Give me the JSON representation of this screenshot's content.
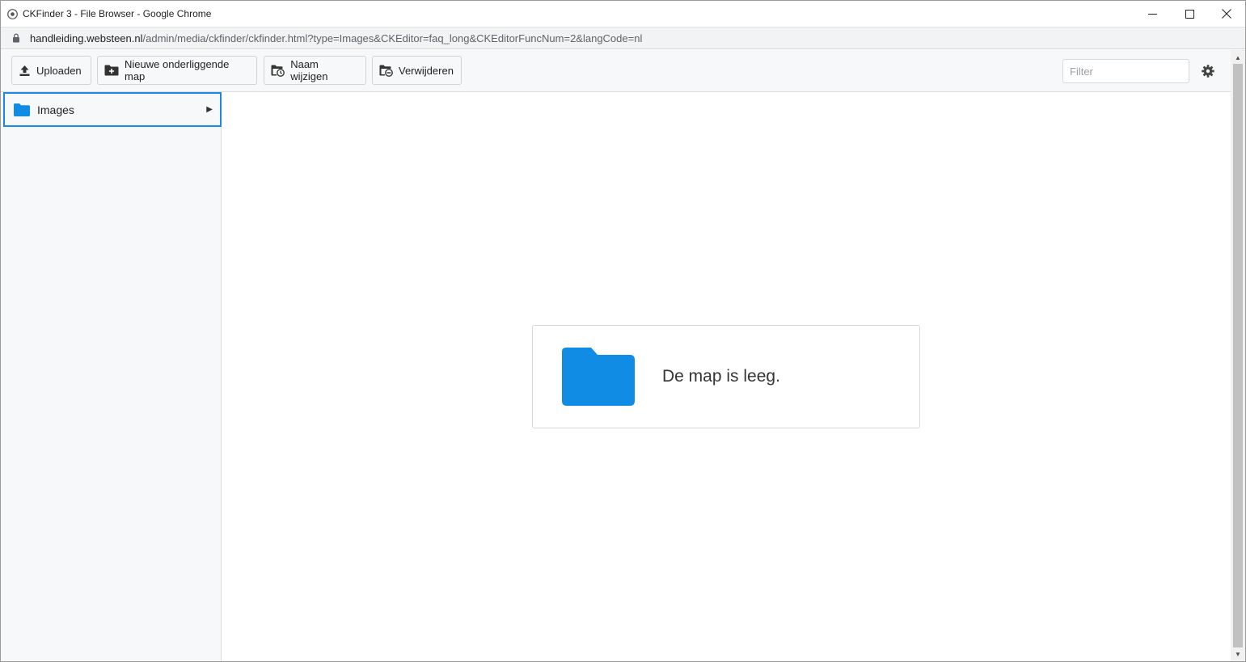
{
  "window": {
    "title": "CKFinder 3 - File Browser - Google Chrome",
    "controls": {
      "minimize": "—",
      "maximize": "☐",
      "close": "✕"
    }
  },
  "address": {
    "host": "handleiding.websteen.nl",
    "path": "/admin/media/ckfinder/ckfinder.html?type=Images&CKEditor=faq_long&CKEditorFuncNum=2&langCode=nl"
  },
  "toolbar": {
    "upload_label": "Uploaden",
    "new_folder_label": "Nieuwe onderliggende map",
    "rename_label": "Naam wijzigen",
    "delete_label": "Verwijderen",
    "filter_placeholder": "Filter",
    "settings_icon": "gear-icon"
  },
  "sidebar": {
    "items": [
      {
        "label": "Images",
        "icon": "folder-icon",
        "expand_icon": "▶"
      }
    ]
  },
  "content": {
    "empty_message": "De map is leeg."
  },
  "colors": {
    "accent": "#1b87e6",
    "folder": "#118ce4",
    "toolbar_bg": "#f7f8f9"
  }
}
